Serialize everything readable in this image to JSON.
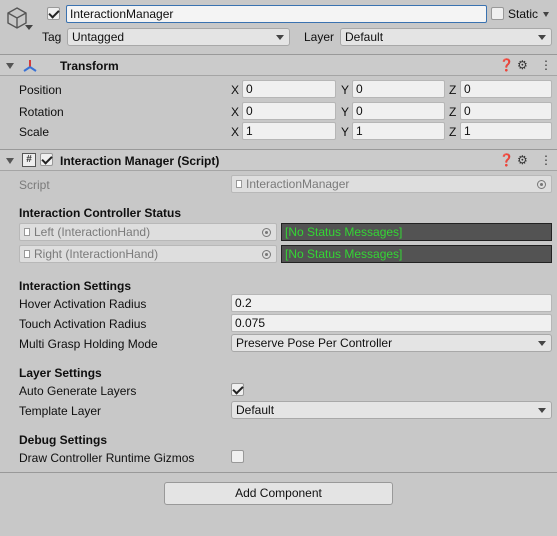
{
  "object": {
    "name": "InteractionManager",
    "active": true,
    "static_label": "Static",
    "static_checked": false,
    "tag_label": "Tag",
    "tag_value": "Untagged",
    "layer_label": "Layer",
    "layer_value": "Default"
  },
  "transform": {
    "title": "Transform",
    "rows": [
      {
        "label": "Position",
        "x": "0",
        "y": "0",
        "z": "0"
      },
      {
        "label": "Rotation",
        "x": "0",
        "y": "0",
        "z": "0"
      },
      {
        "label": "Scale",
        "x": "1",
        "y": "1",
        "z": "1"
      }
    ],
    "axes": [
      "X",
      "Y",
      "Z"
    ]
  },
  "script_component": {
    "title": "Interaction Manager (Script)",
    "enabled": true,
    "script_label": "Script",
    "script_value": "InteractionManager",
    "status_heading": "Interaction Controller Status",
    "controllers": [
      {
        "name": "Left (InteractionHand)",
        "status": "[No Status Messages]"
      },
      {
        "name": "Right (InteractionHand)",
        "status": "[No Status Messages]"
      }
    ],
    "interaction_heading": "Interaction Settings",
    "hover_label": "Hover Activation Radius",
    "hover_value": "0.2",
    "touch_label": "Touch Activation Radius",
    "touch_value": "0.075",
    "grasp_label": "Multi Grasp Holding Mode",
    "grasp_value": "Preserve Pose Per Controller",
    "layer_heading": "Layer Settings",
    "auto_layers_label": "Auto Generate Layers",
    "auto_layers_checked": true,
    "template_label": "Template Layer",
    "template_value": "Default",
    "debug_heading": "Debug Settings",
    "gizmos_label": "Draw Controller Runtime Gizmos",
    "gizmos_checked": false
  },
  "add_component_label": "Add Component",
  "colors": {
    "background": "#c8c8c8",
    "status_text": "#34d634",
    "status_bg": "#535353"
  }
}
